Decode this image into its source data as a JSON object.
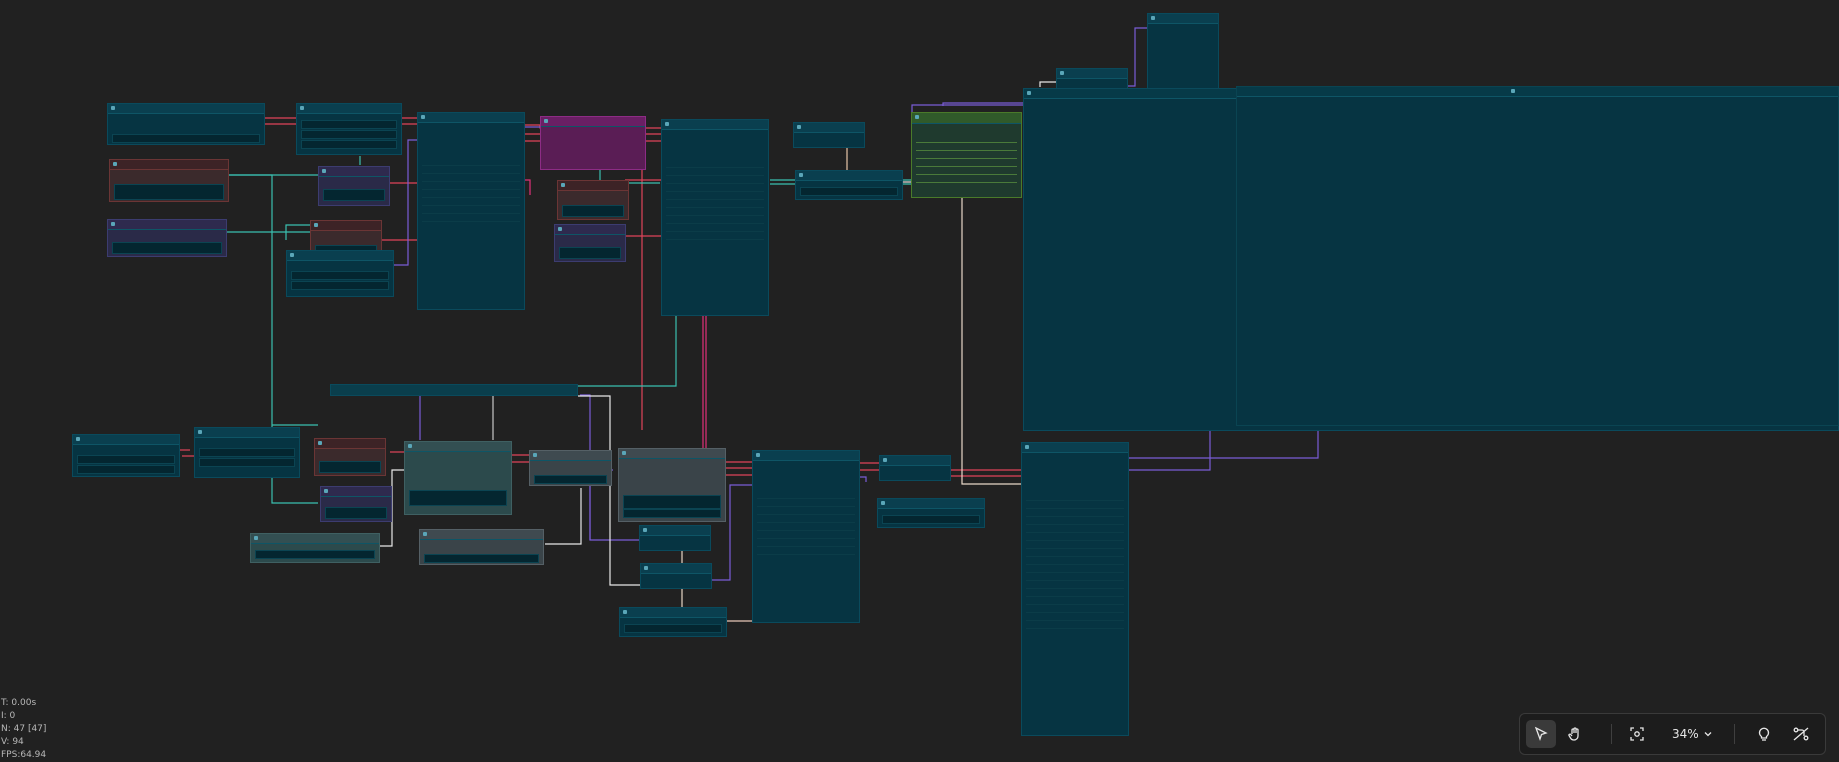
{
  "stats": {
    "time": "T: 0.00s",
    "iterations": "I: 0",
    "nodes": "N: 47 [47]",
    "vertices": "V: 94",
    "fps": "FPS:64.94"
  },
  "toolbar": {
    "select_tool": "pointer-icon",
    "pan_tool": "hand-icon",
    "fit_view": "fit-view-icon",
    "zoom_label": "34%",
    "zoom_dropdown": "chevron-down-icon",
    "hint": "lightbulb-icon",
    "links_toggle": "hide-links-icon"
  },
  "colors": {
    "background": "#212121",
    "node": "#063442",
    "link_red": "#e0445a",
    "link_teal": "#3bbfb0",
    "link_purple": "#7a5cd6",
    "link_white": "#e8e8e8",
    "link_pink": "#e0307a"
  }
}
